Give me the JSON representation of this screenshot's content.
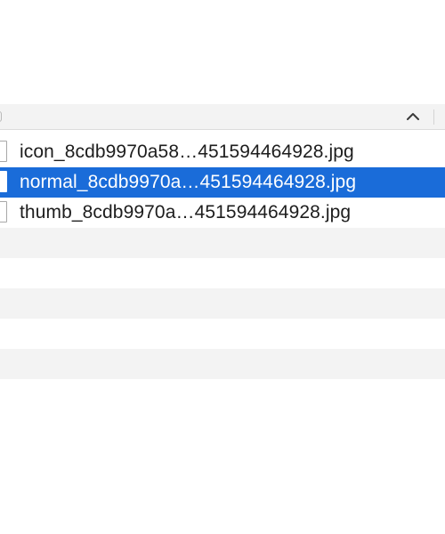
{
  "header": {
    "sort_icon": "chevron-up-icon"
  },
  "files": [
    {
      "name": "icon_8cdb9970a58…451594464928.jpg",
      "icon": "document-icon",
      "selected": false
    },
    {
      "name": "normal_8cdb9970a…451594464928.jpg",
      "icon": "document-icon",
      "selected": true
    },
    {
      "name": "thumb_8cdb9970a…451594464928.jpg",
      "icon": "document-icon",
      "selected": false
    }
  ],
  "colors": {
    "selection": "#1a6cd9",
    "stripe": "#f3f3f3",
    "text": "#1d1d1d"
  }
}
